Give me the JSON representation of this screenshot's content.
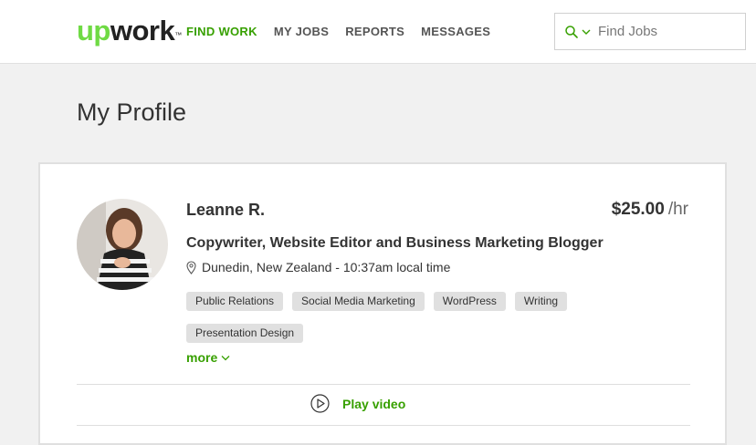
{
  "header": {
    "logo": {
      "up": "up",
      "rest": "work",
      "tm": "™"
    },
    "nav": [
      {
        "label": "FIND WORK",
        "active": true
      },
      {
        "label": "MY JOBS",
        "active": false
      },
      {
        "label": "REPORTS",
        "active": false
      },
      {
        "label": "MESSAGES",
        "active": false
      }
    ],
    "search": {
      "placeholder": "Find Jobs",
      "value": ""
    }
  },
  "page": {
    "title": "My Profile"
  },
  "profile": {
    "name": "Leanne R.",
    "rate": "$25.00",
    "rate_unit": "/hr",
    "headline": "Copywriter, Website Editor and Business Marketing Blogger",
    "location": "Dunedin, New Zealand - 10:37am local time",
    "skills": [
      "Public Relations",
      "Social Media Marketing",
      "WordPress",
      "Writing",
      "Presentation Design"
    ],
    "more_label": "more",
    "video_label": "Play video"
  },
  "colors": {
    "brand_green": "#37a000",
    "logo_green": "#6fda44",
    "skill_bg": "#e0e0e0"
  }
}
